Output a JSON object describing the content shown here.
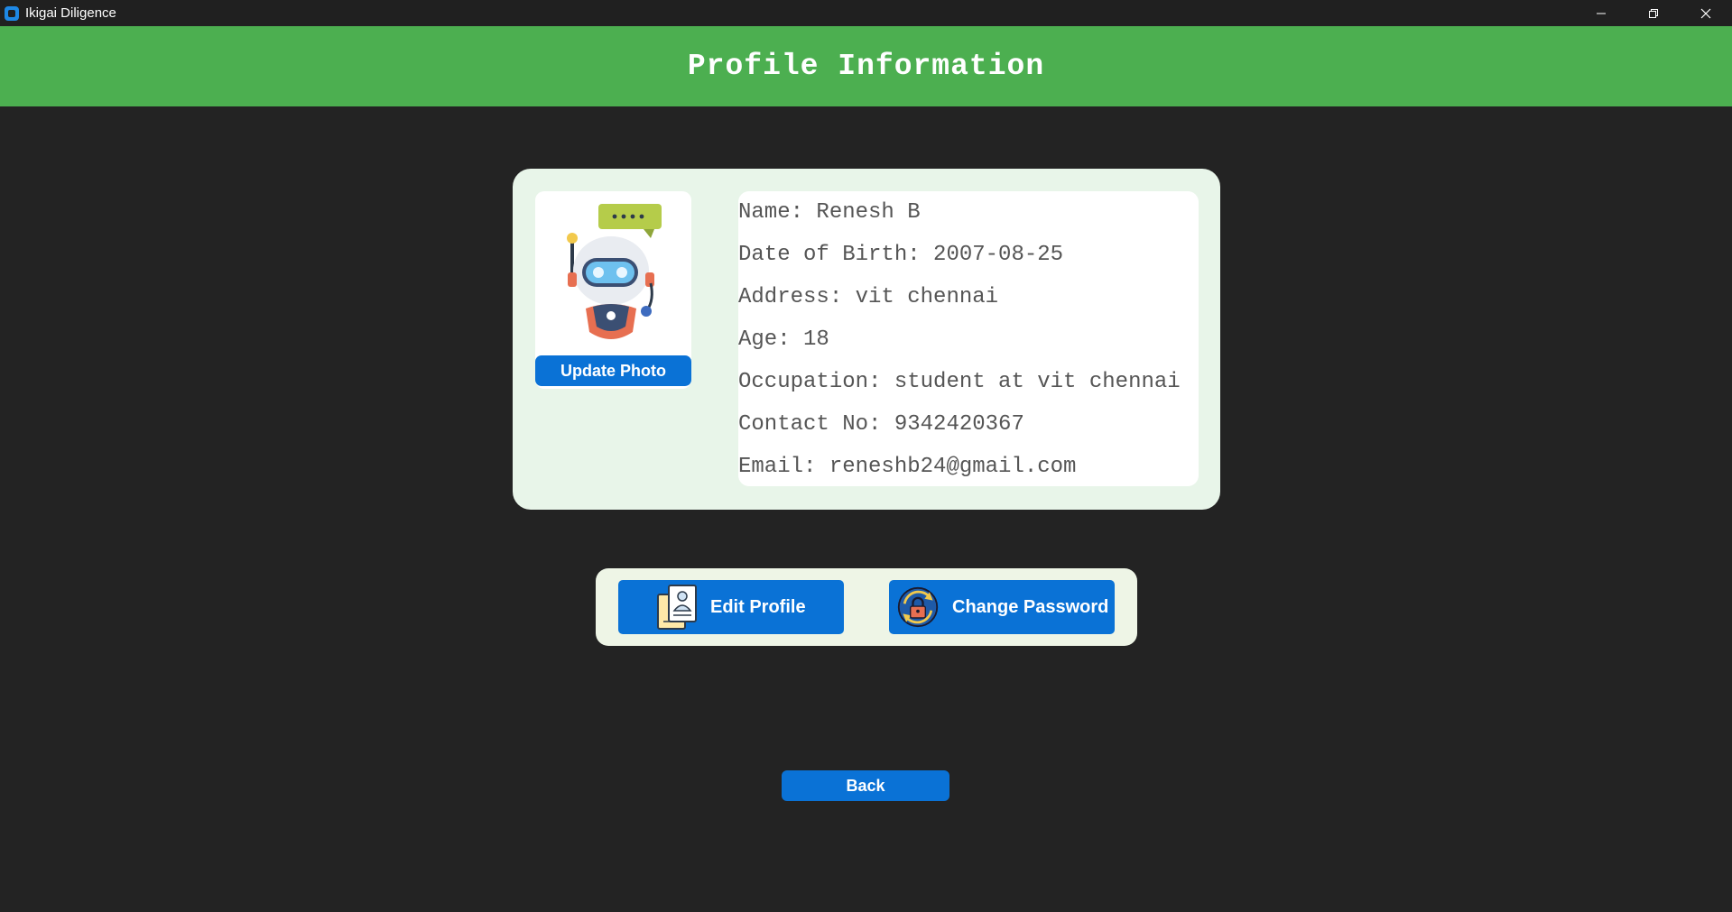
{
  "window": {
    "title": "Ikigai Diligence",
    "app_icon": "app-icon",
    "controls": [
      "minimize-icon",
      "restore-icon",
      "close-icon"
    ]
  },
  "header": {
    "title": "Profile Information",
    "background": "#4caf50"
  },
  "profile": {
    "avatar": "robot-avatar-icon",
    "update_photo_label": "Update Photo",
    "fields": {
      "name": "Name: Renesh B",
      "dob": "Date of Birth: 2007-08-25",
      "address": "Address: vit chennai",
      "age": "Age: 18",
      "occupation": "Occupation: student at vit chennai",
      "contact": "Contact No: 9342420367",
      "email": "Email: reneshb24@gmail.com"
    }
  },
  "actions": {
    "edit_profile_label": "Edit Profile",
    "edit_profile_icon": "profile-document-icon",
    "change_password_label": "Change Password",
    "change_password_icon": "lock-refresh-icon"
  },
  "back_label": "Back",
  "colors": {
    "accent_blue": "#0a72d6",
    "background": "#232323",
    "card": "#e8f5e9"
  }
}
